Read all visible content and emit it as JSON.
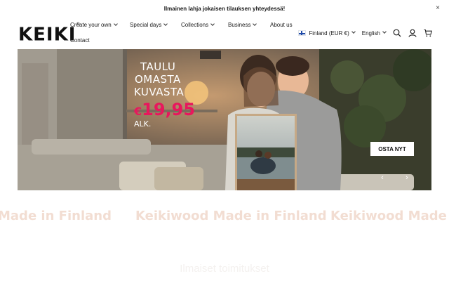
{
  "announcement": {
    "text": "Ilmainen lahja jokaisen tilauksen yhteydessä!",
    "close": "×"
  },
  "logo": {
    "text": "KEIKI",
    "mark": "®"
  },
  "nav": {
    "create": "Create your own",
    "special": "Special days",
    "collections": "Collections",
    "business": "Business",
    "about": "About us",
    "contact": "Contact"
  },
  "utility": {
    "country": "Finland (EUR €)",
    "language": "English"
  },
  "hero": {
    "line1": "TAULU",
    "line2": "OMASTA",
    "line3": "KUVASTA",
    "currency": "€",
    "price": "19,95",
    "suffix": "ALK.",
    "cta": "OSTA NYT",
    "prev": "‹",
    "next": "›"
  },
  "marquee": {
    "items": [
      "Made in Finland",
      "Keikiwood Made in Finland",
      "Keikiwood Made in Finland"
    ]
  },
  "faint_text": "Ilmaiset toimitukset",
  "colors": {
    "price": "#e8175d",
    "marquee": "#f2ddd2"
  }
}
